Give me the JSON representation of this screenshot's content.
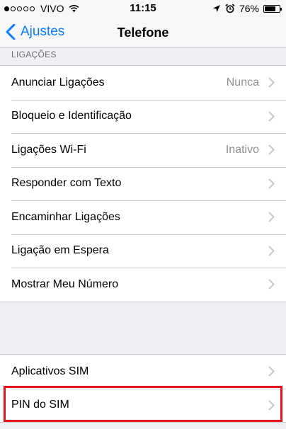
{
  "status_bar": {
    "carrier": "VIVO",
    "time": "11:15",
    "battery": "76%",
    "battery_level": 0.76,
    "signal_bars_filled": 1,
    "signal_bars_total": 5
  },
  "nav": {
    "back_label": "Ajustes",
    "title": "Telefone"
  },
  "section": {
    "header": "LIGAÇÕES"
  },
  "calls_group": [
    {
      "label": "Anunciar Ligações",
      "detail": "Nunca"
    },
    {
      "label": "Bloqueio e Identificação",
      "detail": ""
    },
    {
      "label": "Ligações Wi-Fi",
      "detail": "Inativo"
    },
    {
      "label": "Responder com Texto",
      "detail": ""
    },
    {
      "label": "Encaminhar Ligações",
      "detail": ""
    },
    {
      "label": "Ligação em Espera",
      "detail": ""
    },
    {
      "label": "Mostrar Meu Número",
      "detail": ""
    }
  ],
  "sim_group": [
    {
      "label": "Aplicativos SIM"
    },
    {
      "label": "PIN do SIM"
    }
  ],
  "colors": {
    "accent": "#0a7aff",
    "highlight": "#e0141d",
    "background": "#efeff4"
  }
}
